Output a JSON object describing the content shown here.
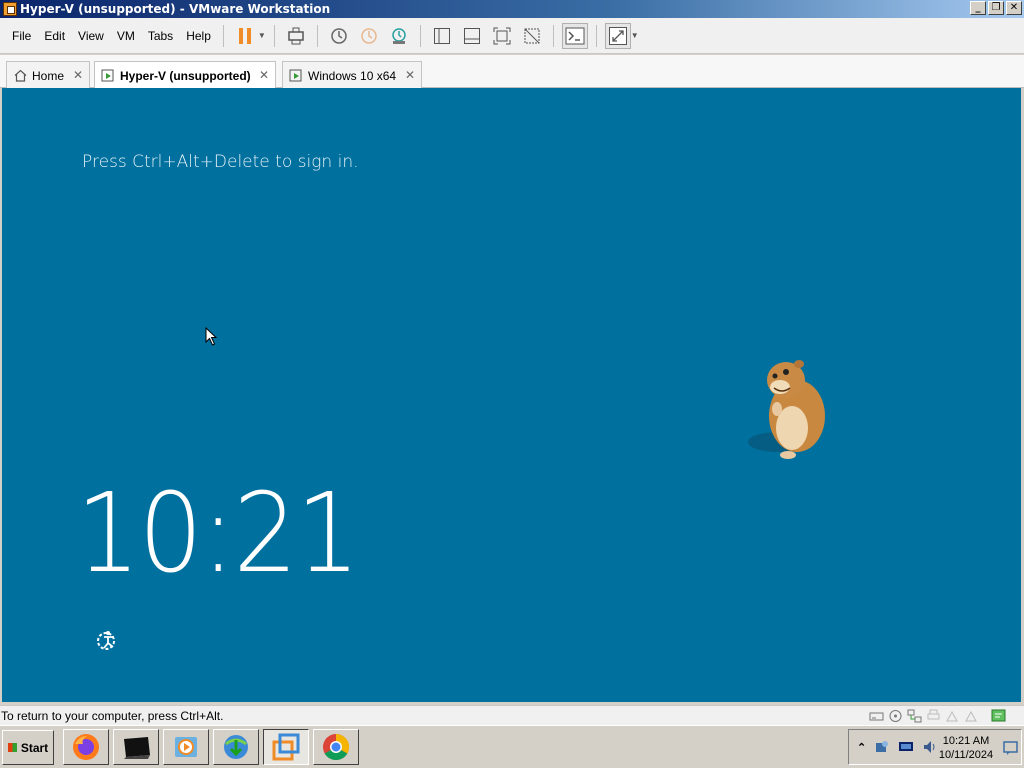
{
  "window": {
    "title": "Hyper-V (unsupported) - VMware Workstation",
    "buttons": [
      "minimize",
      "restore",
      "close"
    ]
  },
  "menu": {
    "items": [
      "File",
      "Edit",
      "View",
      "VM",
      "Tabs",
      "Help"
    ]
  },
  "toolbar": {
    "icons": [
      "pause-icon",
      "send-ctrl-alt-del-icon",
      "snapshot-icon",
      "revert-snapshot-icon",
      "snapshot-manager-icon",
      "library-view-icon",
      "thumbnail-view-icon",
      "fullscreen-icon",
      "unity-icon",
      "console-icon",
      "stretch-guest-icon"
    ],
    "accent": "#f08c28"
  },
  "tabs": [
    {
      "label": "Home",
      "active": false,
      "icon": "home-icon"
    },
    {
      "label": "Hyper-V (unsupported)",
      "active": true,
      "icon": "vm-icon"
    },
    {
      "label": "Windows 10 x64",
      "active": false,
      "icon": "vm-icon"
    }
  ],
  "vm": {
    "signin_text": "Press Ctrl+Alt+Delete to sign in.",
    "clock": "10:21",
    "background": "#00709e"
  },
  "statusbar": {
    "text": "To return to your computer, press Ctrl+Alt."
  },
  "taskbar": {
    "start_label": "Start",
    "apps": [
      "firefox-icon",
      "terminal-icon",
      "media-player-icon",
      "download-manager-icon",
      "vmware-icon",
      "chrome-icon"
    ],
    "active_app": "vmware-icon",
    "tray": {
      "time": "10:21 AM",
      "date": "10/11/2024"
    }
  }
}
